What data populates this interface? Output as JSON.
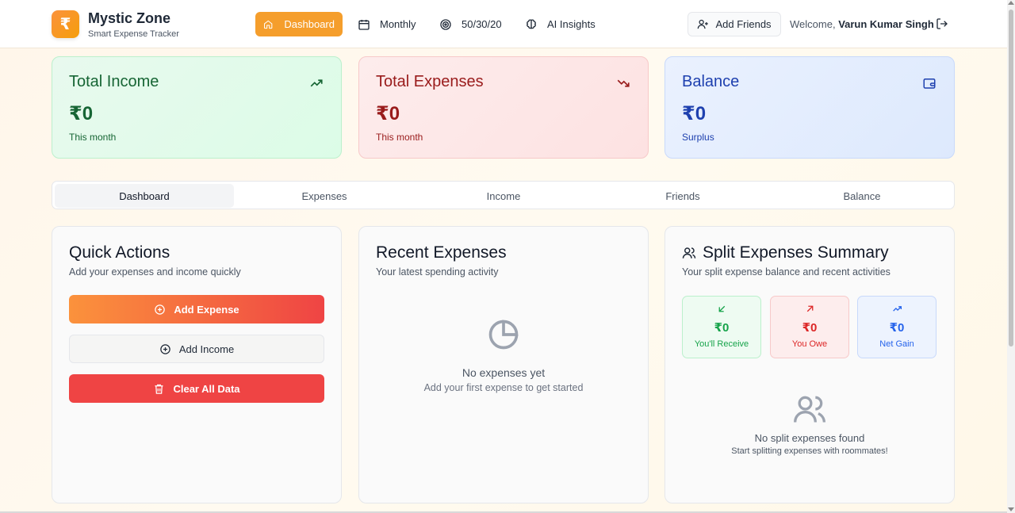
{
  "header": {
    "logo_symbol": "₹",
    "app_name": "Mystic Zone",
    "app_subtitle": "Smart Expense Tracker",
    "nav": [
      {
        "label": "Dashboard",
        "icon": "home-icon",
        "active": true
      },
      {
        "label": "Monthly",
        "icon": "calendar-icon"
      },
      {
        "label": "50/30/20",
        "icon": "target-icon"
      },
      {
        "label": "AI Insights",
        "icon": "brain-icon"
      }
    ],
    "add_friends_label": "Add Friends",
    "welcome_prefix": "Welcome,",
    "user_name": "Varun Kumar Singh"
  },
  "stats": {
    "income": {
      "title": "Total Income",
      "value": "₹0",
      "note": "This month"
    },
    "expenses": {
      "title": "Total Expenses",
      "value": "₹0",
      "note": "This month"
    },
    "balance": {
      "title": "Balance",
      "value": "₹0",
      "note": "Surplus"
    }
  },
  "tabs": [
    {
      "label": "Dashboard",
      "active": true
    },
    {
      "label": "Expenses"
    },
    {
      "label": "Income"
    },
    {
      "label": "Friends"
    },
    {
      "label": "Balance"
    }
  ],
  "quick_actions": {
    "title": "Quick Actions",
    "subtitle": "Add your expenses and income quickly",
    "add_expense": "Add Expense",
    "add_income": "Add Income",
    "clear_data": "Clear All Data"
  },
  "recent_expenses": {
    "title": "Recent Expenses",
    "subtitle": "Your latest spending activity",
    "empty_title": "No expenses yet",
    "empty_sub": "Add your first expense to get started"
  },
  "split_summary": {
    "title": "Split Expenses Summary",
    "subtitle": "Your split expense balance and recent activities",
    "receive": {
      "value": "₹0",
      "label": "You'll Receive"
    },
    "owe": {
      "value": "₹0",
      "label": "You Owe"
    },
    "gain": {
      "value": "₹0",
      "label": "Net Gain"
    },
    "empty_title": "No split expenses found",
    "empty_sub": "Start splitting expenses with roommates!"
  },
  "colors": {
    "accent": "#f59e2c",
    "income": "#166534",
    "expense": "#991b1b",
    "balance": "#1e40af",
    "danger": "#ef4444"
  }
}
